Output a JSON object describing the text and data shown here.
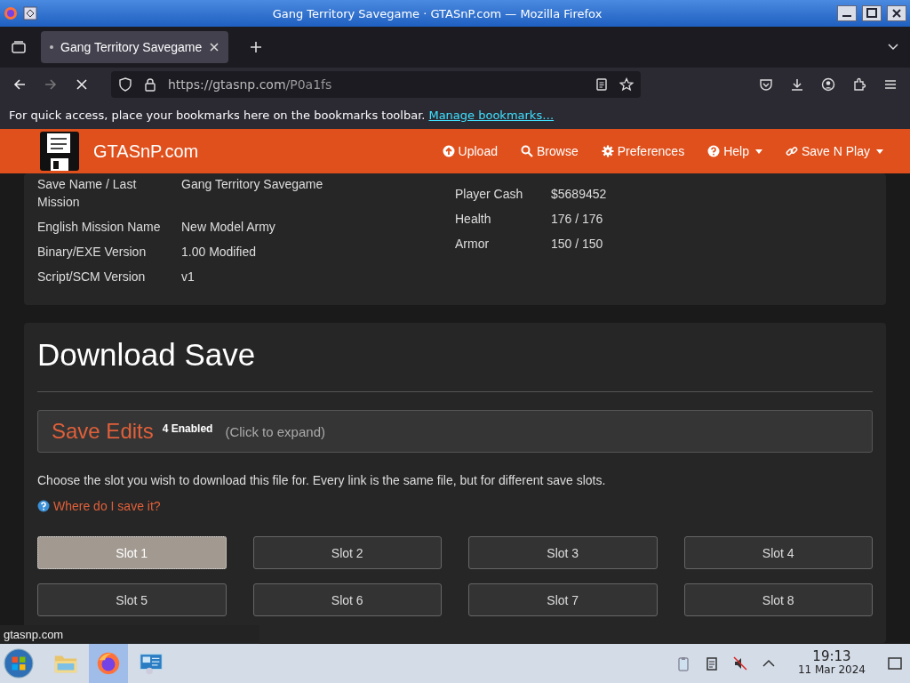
{
  "window": {
    "title": "Gang Territory Savegame · GTASnP.com — Mozilla Firefox"
  },
  "tabs": [
    {
      "label": "Gang Territory Savegame",
      "selected": true
    }
  ],
  "address_bar": {
    "url_host": "https://gtasnp.com",
    "url_path": "/P0a1fs"
  },
  "bookmarks_bar": {
    "message": "For quick access, place your bookmarks here on the bookmarks toolbar.",
    "link": "Manage bookmarks…"
  },
  "site_nav": {
    "brand": "GTASnP.com",
    "items": [
      {
        "label": "Upload",
        "kind": "upload",
        "dropdown": false
      },
      {
        "label": "Browse",
        "kind": "search",
        "dropdown": false
      },
      {
        "label": "Preferences",
        "kind": "gear",
        "dropdown": false
      },
      {
        "label": "Help",
        "kind": "help",
        "dropdown": true
      },
      {
        "label": "Save N Play",
        "kind": "link",
        "dropdown": true
      }
    ]
  },
  "save_info": {
    "left": [
      {
        "label": "Save Name / Last Mission",
        "value": "Gang Territory Savegame"
      },
      {
        "label": "English Mission Name",
        "value": "New Model Army"
      },
      {
        "label": "Binary/EXE Version",
        "value": "1.00 Modified"
      },
      {
        "label": "Script/SCM Version",
        "value": "v1"
      }
    ],
    "right": [
      {
        "label": "Player Cash",
        "value": "$5689452"
      },
      {
        "label": "Health",
        "value": "176 / 176"
      },
      {
        "label": "Armor",
        "value": "150 / 150"
      }
    ]
  },
  "download": {
    "title": "Download Save",
    "edits": {
      "title": "Save Edits",
      "badge": "4 Enabled",
      "hint": "(Click to expand)"
    },
    "description": "Choose the slot you wish to download this file for. Every link is the same file, but for different save slots.",
    "help_link": "Where do I save it?",
    "slots": [
      {
        "label": "Slot 1",
        "selected": true
      },
      {
        "label": "Slot 2",
        "selected": false
      },
      {
        "label": "Slot 3",
        "selected": false
      },
      {
        "label": "Slot 4",
        "selected": false
      },
      {
        "label": "Slot 5",
        "selected": false
      },
      {
        "label": "Slot 6",
        "selected": false
      },
      {
        "label": "Slot 7",
        "selected": false
      },
      {
        "label": "Slot 8",
        "selected": false
      }
    ]
  },
  "status_text": "gtasnp.com",
  "taskbar": {
    "time": "19:13",
    "date": "11 Mar 2024"
  }
}
